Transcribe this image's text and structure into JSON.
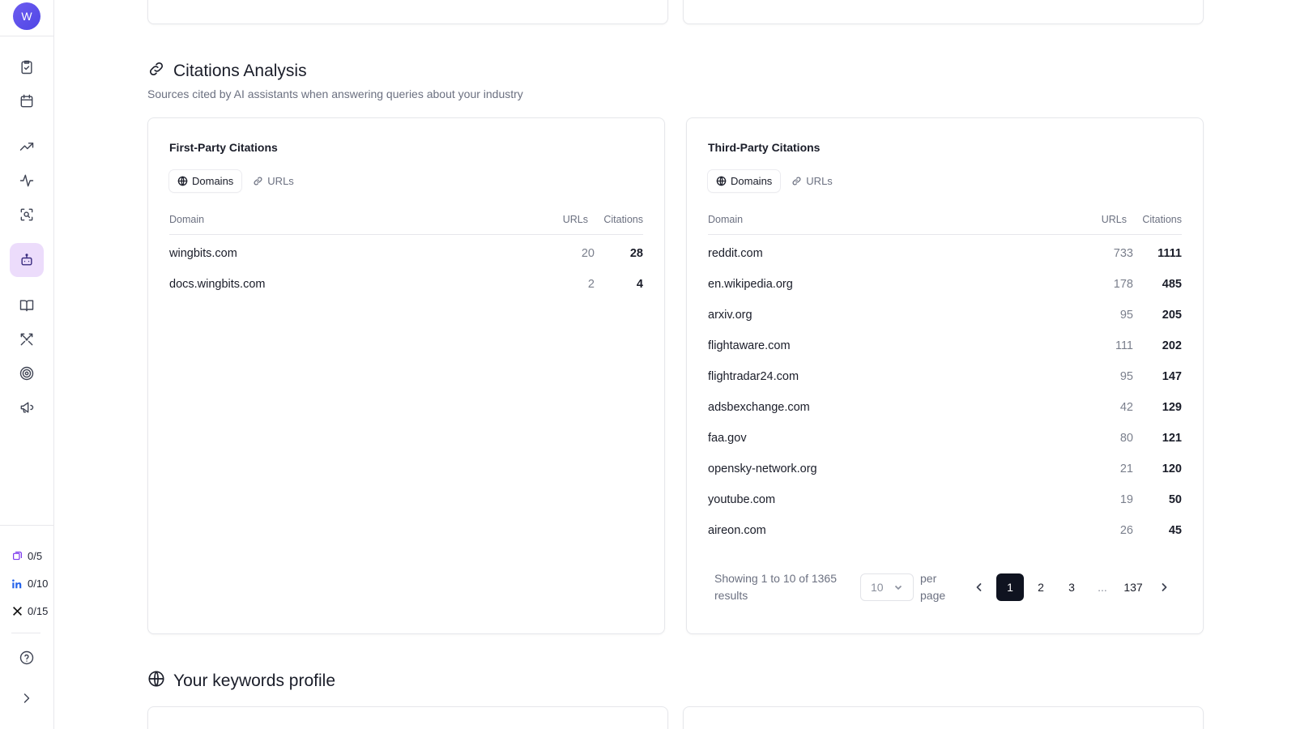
{
  "sidebar": {
    "avatar_initial": "W",
    "quotas": [
      {
        "icon": "stack-icon",
        "label": "0/5",
        "color": "#7c3aed"
      },
      {
        "icon": "linkedin-icon",
        "label": "0/10",
        "color": "#2563eb"
      },
      {
        "icon": "x-icon",
        "label": "0/15",
        "color": "#111111"
      }
    ]
  },
  "citations": {
    "title": "Citations Analysis",
    "subtitle": "Sources cited by AI assistants when answering queries about your industry",
    "first_party": {
      "title": "First-Party Citations",
      "tabs": [
        "Domains",
        "URLs"
      ],
      "columns": {
        "domain": "Domain",
        "urls": "URLs",
        "citations": "Citations"
      },
      "rows": [
        {
          "domain": "wingbits.com",
          "urls": "20",
          "citations": "28"
        },
        {
          "domain": "docs.wingbits.com",
          "urls": "2",
          "citations": "4"
        }
      ]
    },
    "third_party": {
      "title": "Third-Party Citations",
      "tabs": [
        "Domains",
        "URLs"
      ],
      "columns": {
        "domain": "Domain",
        "urls": "URLs",
        "citations": "Citations"
      },
      "rows": [
        {
          "domain": "reddit.com",
          "urls": "733",
          "citations": "1111"
        },
        {
          "domain": "en.wikipedia.org",
          "urls": "178",
          "citations": "485"
        },
        {
          "domain": "arxiv.org",
          "urls": "95",
          "citations": "205"
        },
        {
          "domain": "flightaware.com",
          "urls": "111",
          "citations": "202"
        },
        {
          "domain": "flightradar24.com",
          "urls": "95",
          "citations": "147"
        },
        {
          "domain": "adsbexchange.com",
          "urls": "42",
          "citations": "129"
        },
        {
          "domain": "faa.gov",
          "urls": "80",
          "citations": "121"
        },
        {
          "domain": "opensky-network.org",
          "urls": "21",
          "citations": "120"
        },
        {
          "domain": "youtube.com",
          "urls": "19",
          "citations": "50"
        },
        {
          "domain": "aireon.com",
          "urls": "26",
          "citations": "45"
        }
      ],
      "pagination": {
        "info": "Showing 1 to 10 of 1365 results",
        "per_page_value": "10",
        "per_page_label": "per page",
        "pages": [
          "1",
          "2",
          "3",
          "...",
          "137"
        ],
        "current": "1"
      }
    }
  },
  "keywords": {
    "title": "Your keywords profile"
  }
}
